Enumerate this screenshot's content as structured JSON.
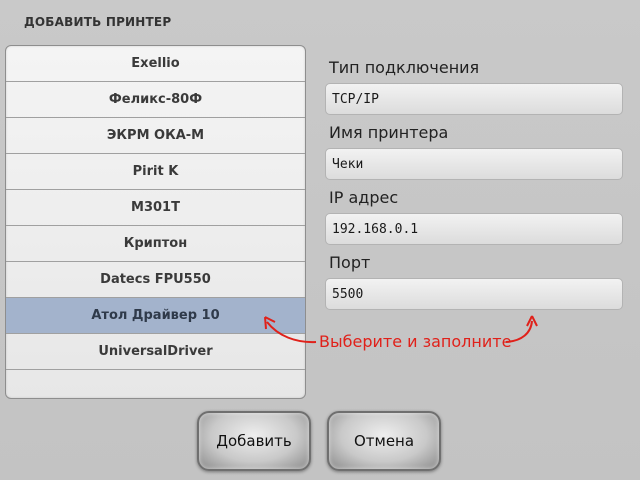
{
  "dialog": {
    "title": "ДОБАВИТЬ ПРИНТЕР"
  },
  "printer_list": {
    "items": [
      {
        "label": "Exellio"
      },
      {
        "label": "Феликс-80Ф"
      },
      {
        "label": "ЭКРМ ОКА-М"
      },
      {
        "label": "Pirit K"
      },
      {
        "label": "M301T"
      },
      {
        "label": "Криптон"
      },
      {
        "label": "Datecs FPU550"
      },
      {
        "label": "Атол Драйвер 10"
      },
      {
        "label": "UniversalDriver"
      }
    ],
    "selected_label": "Атол Драйвер 10"
  },
  "form": {
    "connection_type": {
      "label": "Тип подключения",
      "value": "TCP/IP"
    },
    "printer_name": {
      "label": "Имя принтера",
      "value": "Чеки"
    },
    "ip_address": {
      "label": "IP адрес",
      "value": "192.168.0.1"
    },
    "port": {
      "label": "Порт",
      "value": "5500"
    }
  },
  "hint": {
    "text": "Выберите и заполните",
    "color": "#e0211a"
  },
  "buttons": {
    "add": "Добавить",
    "cancel": "Отмена"
  },
  "colors": {
    "selected_row": "#a3b3cc",
    "window_bg": "#c6c6c6"
  }
}
